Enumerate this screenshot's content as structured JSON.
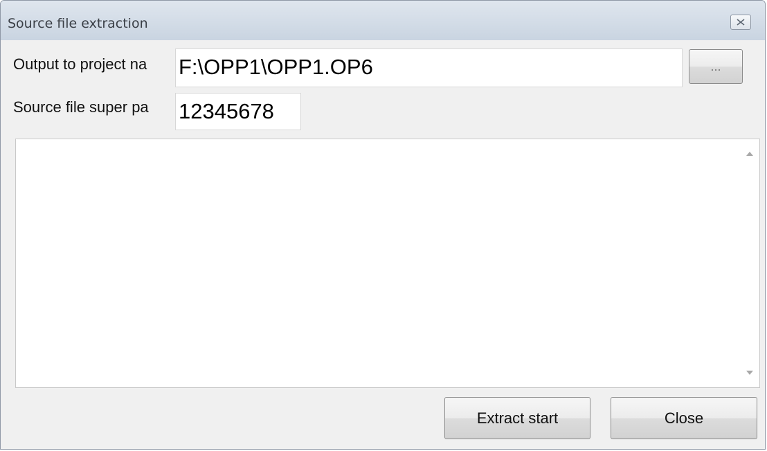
{
  "window": {
    "title": "Source file extraction",
    "close_icon": "close-x-icon"
  },
  "form": {
    "output_label": "Output to project na",
    "output_value": "F:\\OPP1\\OPP1.OP6",
    "browse_label": "...",
    "password_label": "Source file super pa",
    "password_value": "12345678"
  },
  "log": {
    "text": ""
  },
  "buttons": {
    "extract": "Extract start",
    "close": "Close"
  }
}
